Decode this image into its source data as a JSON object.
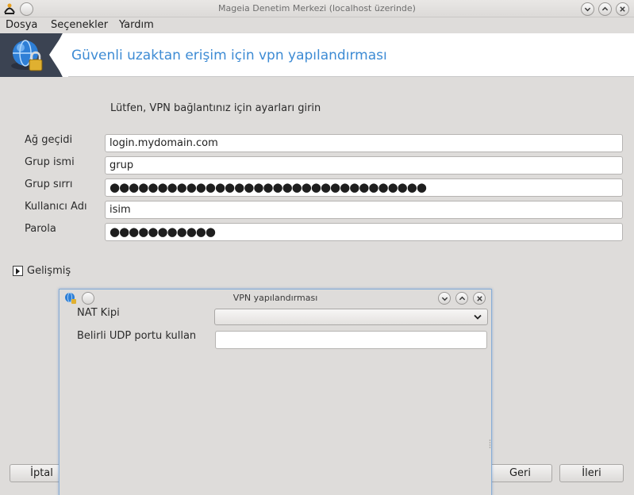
{
  "window": {
    "title": "Mageia Denetim Merkezi  (localhost üzerinde)"
  },
  "menu": {
    "items": [
      "Dosya",
      "Seçenekler",
      "Yardım"
    ]
  },
  "banner": {
    "title": "Güvenli uzaktan erişim için vpn yapılandırması",
    "icon": "vpn-globe-lock-icon"
  },
  "form": {
    "intro": "Lütfen, VPN bağlantınız için ayarları girin",
    "fields": [
      {
        "label": "Ağ geçidi",
        "value": "login.mydomain.com"
      },
      {
        "label": "Grup ismi",
        "value": "grup"
      },
      {
        "label": "Grup sırrı",
        "value": "●●●●●●●●●●●●●●●●●●●●●●●●●●●●●●●●●"
      },
      {
        "label": "Kullanıcı Adı",
        "value": "isim"
      },
      {
        "label": "Parola",
        "value": "●●●●●●●●●●●"
      }
    ],
    "advanced_label": "Gelişmiş"
  },
  "buttons": {
    "cancel": "İptal",
    "back": "Geri",
    "next": "İleri"
  },
  "dialog": {
    "title": "VPN yapılandırması",
    "nat_label": "NAT Kipi",
    "nat_value": "",
    "udp_label": "Belirli UDP portu kullan",
    "udp_value": ""
  },
  "colors": {
    "accent": "#3d8bd4",
    "banner_dark": "#3b4352",
    "background": "#dedcda",
    "dialog_border": "#88aed6"
  }
}
